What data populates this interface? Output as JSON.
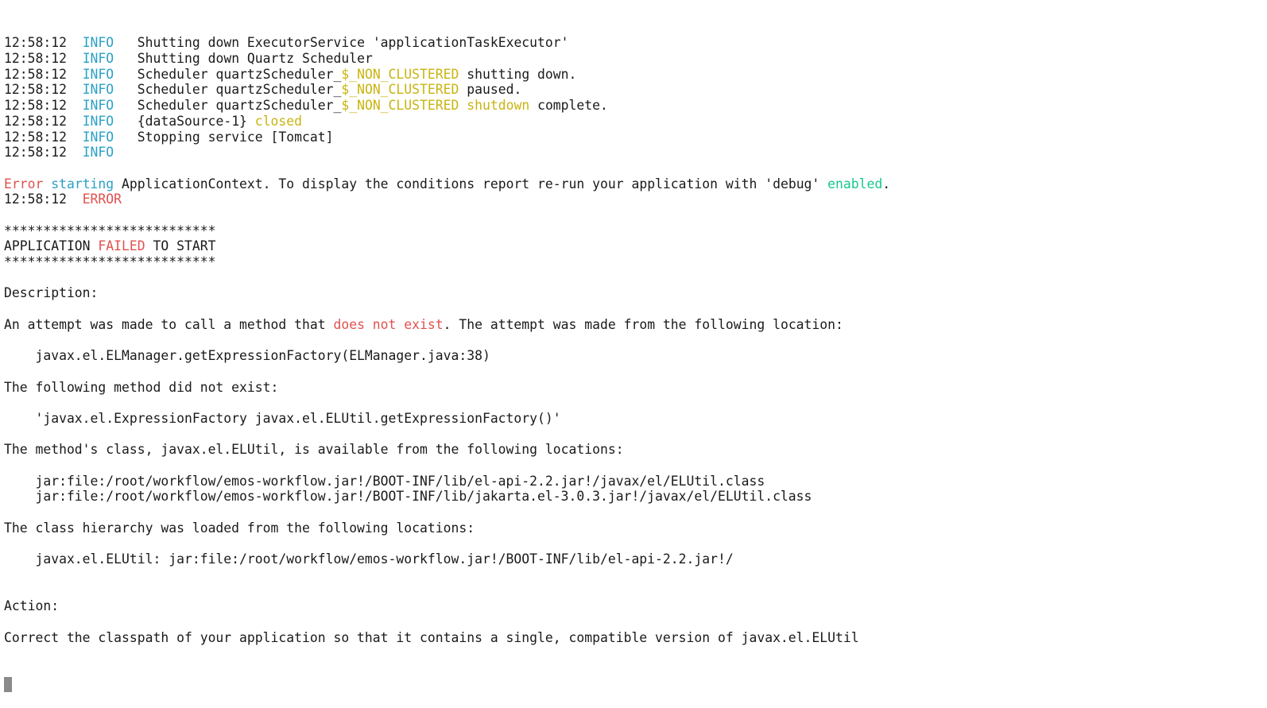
{
  "colors": {
    "background": "#ffffff",
    "default_text": "#1a1a1a",
    "info": "#2aa1c4",
    "error": "#e0524f",
    "yellow": "#c9b410",
    "green": "#16c98a",
    "cursor": "#8a8a8a"
  },
  "lines": [
    [
      {
        "t": "12:58:12  ",
        "c": "default"
      },
      {
        "t": "INFO",
        "c": "info"
      },
      {
        "t": "   Shutting down ExecutorService 'applicationTaskExecutor'",
        "c": "default"
      }
    ],
    [
      {
        "t": "12:58:12  ",
        "c": "default"
      },
      {
        "t": "INFO",
        "c": "info"
      },
      {
        "t": "   Shutting down Quartz Scheduler",
        "c": "default"
      }
    ],
    [
      {
        "t": "12:58:12  ",
        "c": "default"
      },
      {
        "t": "INFO",
        "c": "info"
      },
      {
        "t": "   Scheduler quartzScheduler_",
        "c": "default"
      },
      {
        "t": "$_NON_CLUSTERED",
        "c": "yellow"
      },
      {
        "t": " shutting down.",
        "c": "default"
      }
    ],
    [
      {
        "t": "12:58:12  ",
        "c": "default"
      },
      {
        "t": "INFO",
        "c": "info"
      },
      {
        "t": "   Scheduler quartzScheduler_",
        "c": "default"
      },
      {
        "t": "$_NON_CLUSTERED",
        "c": "yellow"
      },
      {
        "t": " paused.",
        "c": "default"
      }
    ],
    [
      {
        "t": "12:58:12  ",
        "c": "default"
      },
      {
        "t": "INFO",
        "c": "info"
      },
      {
        "t": "   Scheduler quartzScheduler_",
        "c": "default"
      },
      {
        "t": "$_NON_CLUSTERED",
        "c": "yellow"
      },
      {
        "t": " ",
        "c": "default"
      },
      {
        "t": "shutdown",
        "c": "yellow"
      },
      {
        "t": " complete.",
        "c": "default"
      }
    ],
    [
      {
        "t": "12:58:12  ",
        "c": "default"
      },
      {
        "t": "INFO",
        "c": "info"
      },
      {
        "t": "   {dataSource-1} ",
        "c": "default"
      },
      {
        "t": "closed",
        "c": "yellow"
      }
    ],
    [
      {
        "t": "12:58:12  ",
        "c": "default"
      },
      {
        "t": "INFO",
        "c": "info"
      },
      {
        "t": "   Stopping service [Tomcat]",
        "c": "default"
      }
    ],
    [
      {
        "t": "12:58:12  ",
        "c": "default"
      },
      {
        "t": "INFO",
        "c": "info"
      }
    ],
    [],
    [
      {
        "t": "Error",
        "c": "error"
      },
      {
        "t": " ",
        "c": "default"
      },
      {
        "t": "starting",
        "c": "info"
      },
      {
        "t": " ApplicationContext. To display the conditions report re-run your application with 'debug' ",
        "c": "default"
      },
      {
        "t": "enabled",
        "c": "green"
      },
      {
        "t": ".",
        "c": "default"
      }
    ],
    [
      {
        "t": "12:58:12  ",
        "c": "default"
      },
      {
        "t": "ERROR",
        "c": "error"
      }
    ],
    [],
    [
      {
        "t": "***************************",
        "c": "default"
      }
    ],
    [
      {
        "t": "APPLICATION ",
        "c": "default"
      },
      {
        "t": "FAILED",
        "c": "error"
      },
      {
        "t": " TO START",
        "c": "default"
      }
    ],
    [
      {
        "t": "***************************",
        "c": "default"
      }
    ],
    [],
    [
      {
        "t": "Description:",
        "c": "default"
      }
    ],
    [],
    [
      {
        "t": "An attempt was made to call a method that ",
        "c": "default"
      },
      {
        "t": "does not exist",
        "c": "error"
      },
      {
        "t": ". The attempt was made from the following location:",
        "c": "default"
      }
    ],
    [],
    [
      {
        "t": "    javax.el.ELManager.getExpressionFactory(ELManager.java:38)",
        "c": "default"
      }
    ],
    [],
    [
      {
        "t": "The following method did not exist:",
        "c": "default"
      }
    ],
    [],
    [
      {
        "t": "    'javax.el.ExpressionFactory javax.el.ELUtil.getExpressionFactory()'",
        "c": "default"
      }
    ],
    [],
    [
      {
        "t": "The method's class, javax.el.ELUtil, is available from the following locations:",
        "c": "default"
      }
    ],
    [],
    [
      {
        "t": "    jar:file:/root/workflow/emos-workflow.jar!/BOOT-INF/lib/el-api-2.2.jar!/javax/el/ELUtil.class",
        "c": "default"
      }
    ],
    [
      {
        "t": "    jar:file:/root/workflow/emos-workflow.jar!/BOOT-INF/lib/jakarta.el-3.0.3.jar!/javax/el/ELUtil.class",
        "c": "default"
      }
    ],
    [],
    [
      {
        "t": "The class hierarchy was loaded from the following locations:",
        "c": "default"
      }
    ],
    [],
    [
      {
        "t": "    javax.el.ELUtil: jar:file:/root/workflow/emos-workflow.jar!/BOOT-INF/lib/el-api-2.2.jar!/",
        "c": "default"
      }
    ],
    [],
    [],
    [
      {
        "t": "Action:",
        "c": "default"
      }
    ],
    [],
    [
      {
        "t": "Correct the classpath of your application so that it contains a single, compatible version of javax.el.ELUtil",
        "c": "default"
      }
    ]
  ]
}
